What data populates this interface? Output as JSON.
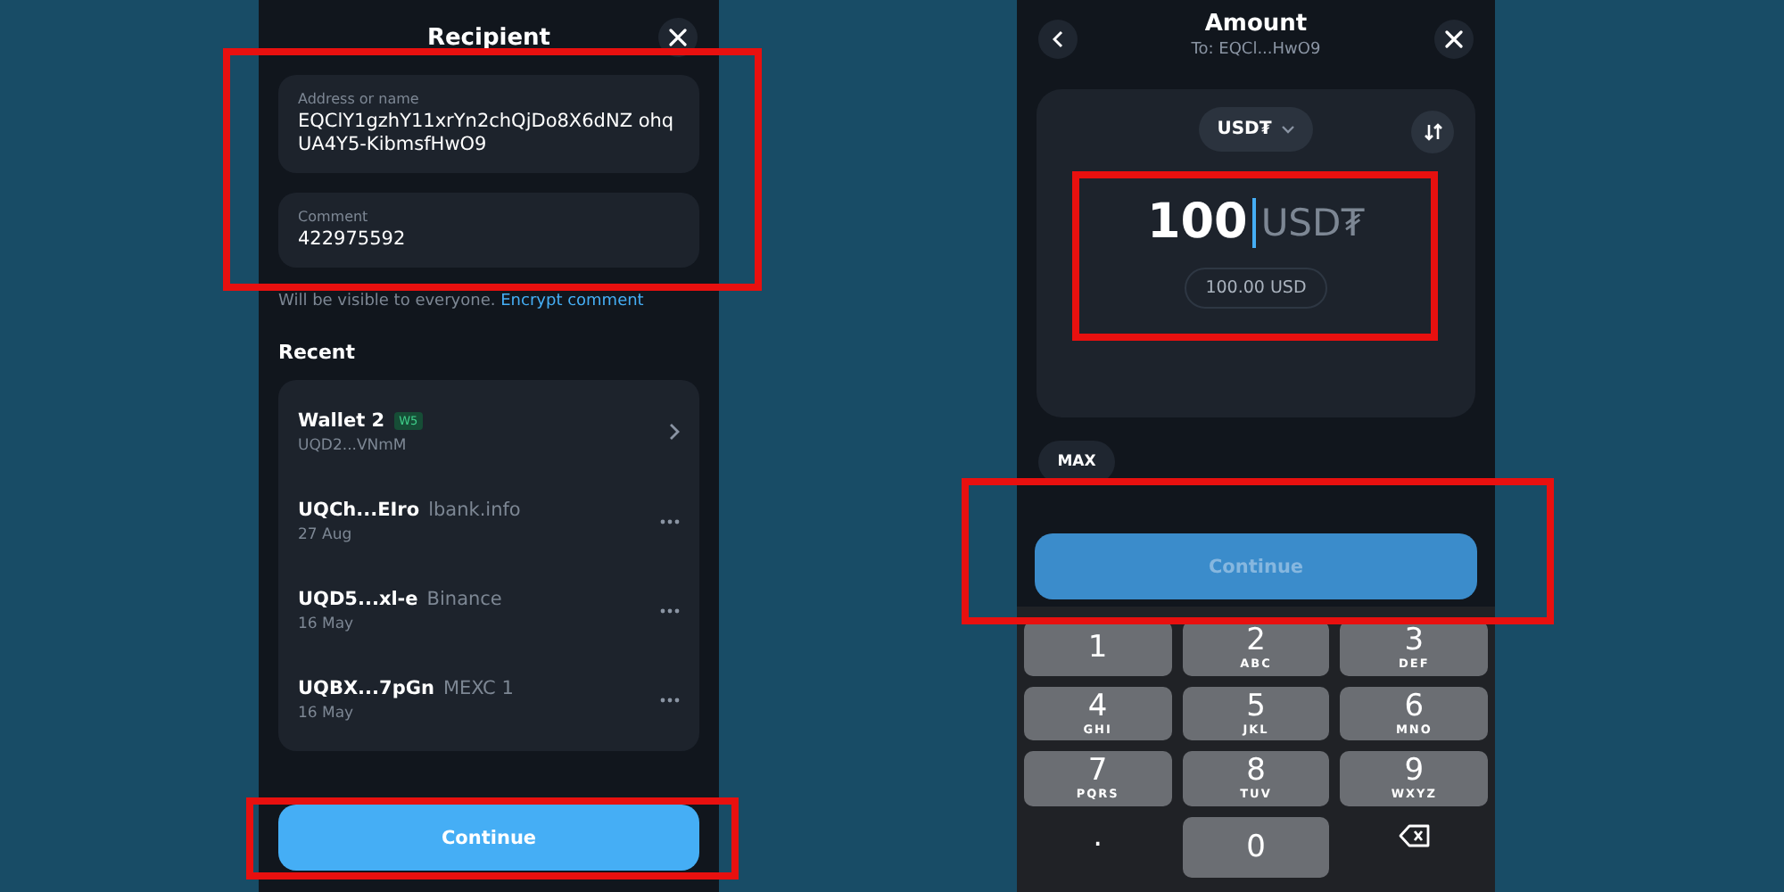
{
  "recipient_screen": {
    "title": "Recipient",
    "address": {
      "label": "Address or name",
      "value": "EQClY1gzhY11xrYn2chQjDo8X6dNZ ohqUA4Y5-KibmsfHwO9"
    },
    "comment": {
      "label": "Comment",
      "value": "422975592"
    },
    "note": {
      "text": "Will be visible to everyone.",
      "link": "Encrypt comment"
    },
    "recent": {
      "heading": "Recent",
      "items": [
        {
          "kind": "wallet",
          "name": "Wallet 2",
          "badge": "W5",
          "subtitle": "UQD2...VNmM"
        },
        {
          "kind": "contact",
          "name": "UQCh...EIro",
          "tag": "lbank.info",
          "subtitle": "27 Aug"
        },
        {
          "kind": "contact",
          "name": "UQD5...xl-e",
          "tag": "Binance",
          "subtitle": "16 May"
        },
        {
          "kind": "contact",
          "name": "UQBX...7pGn",
          "tag": "MEXC 1",
          "subtitle": "16 May"
        }
      ]
    },
    "continue_button": {
      "label": "Continue",
      "disabled": false
    }
  },
  "amount_screen": {
    "title": "Amount",
    "subtitle": "To: EQCl...HwO9",
    "currency": "USD₮",
    "amount": "100",
    "unit": "USD₮",
    "converted": "100.00 USD",
    "max_button": "MAX",
    "continue_button": {
      "label": "Continue",
      "disabled": true
    },
    "keypad": [
      {
        "kind": "digit",
        "digit": "1"
      },
      {
        "kind": "digit",
        "digit": "2",
        "letters": "ABC"
      },
      {
        "kind": "digit",
        "digit": "3",
        "letters": "DEF"
      },
      {
        "kind": "digit",
        "digit": "4",
        "letters": "GHI"
      },
      {
        "kind": "digit",
        "digit": "5",
        "letters": "JKL"
      },
      {
        "kind": "digit",
        "digit": "6",
        "letters": "MNO"
      },
      {
        "kind": "digit",
        "digit": "7",
        "letters": "PQRS"
      },
      {
        "kind": "digit",
        "digit": "8",
        "letters": "TUV"
      },
      {
        "kind": "digit",
        "digit": "9",
        "letters": "WXYZ"
      },
      {
        "kind": "dot",
        "digit": "."
      },
      {
        "kind": "digit",
        "digit": "0"
      },
      {
        "kind": "backspace"
      }
    ]
  }
}
